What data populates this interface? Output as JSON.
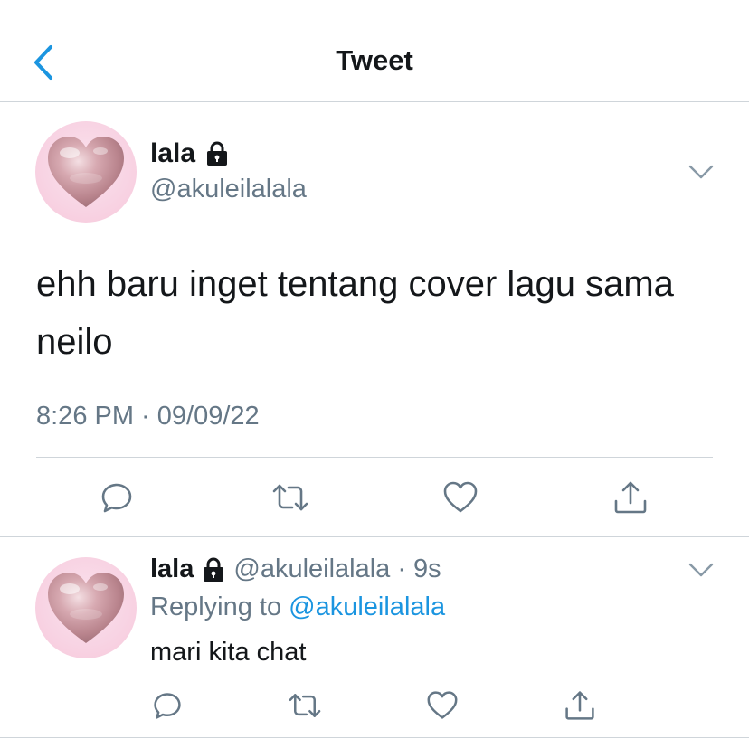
{
  "nav": {
    "title": "Tweet",
    "back_icon": "chevron-left-icon",
    "accent_color": "#1b95e0"
  },
  "main_tweet": {
    "display_name": "lala",
    "lock_icon": "lock-icon",
    "handle": "@akuleilalala",
    "text": "ehh baru inget tentang cover lagu sama neilo",
    "timestamp": "8:26 PM · 09/09/22",
    "actions": [
      "reply-icon",
      "retweet-icon",
      "like-icon",
      "share-icon"
    ]
  },
  "reply_tweet": {
    "display_name": "lala",
    "handle": "@akuleilalala",
    "separator": "·",
    "time_ago": "9s",
    "replying_prefix": "Replying to",
    "replying_handle": "@akuleilalala",
    "text": "mari kita chat",
    "actions": [
      "reply-icon",
      "retweet-icon",
      "like-icon",
      "share-icon"
    ]
  },
  "colors": {
    "text_primary": "#14171a",
    "text_secondary": "#657786",
    "link": "#1b95e0",
    "divider": "#cfd5da",
    "avatar_bg": "#f8d3e3"
  }
}
